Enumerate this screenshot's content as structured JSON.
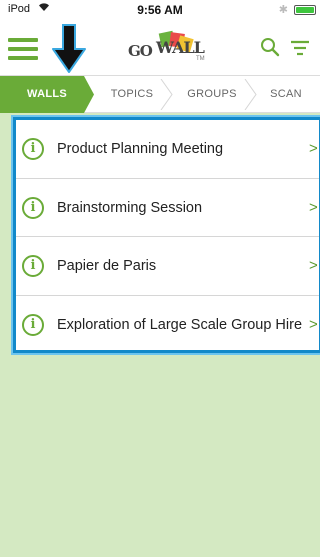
{
  "status_bar": {
    "carrier": "iPod",
    "time": "9:56 AM"
  },
  "header": {
    "logo": {
      "go": "GO",
      "wall": "WALL",
      "tm": "TM"
    },
    "icons": {
      "menu": "hamburger-menu-icon",
      "search": "search-icon",
      "filter": "filter-icon"
    }
  },
  "tabs": [
    {
      "label": "WALLS",
      "active": true
    },
    {
      "label": "TOPICS",
      "active": false
    },
    {
      "label": "GROUPS",
      "active": false
    },
    {
      "label": "SCAN",
      "active": false
    }
  ],
  "walls": {
    "items": [
      {
        "title": "Product Planning Meeting",
        "icon": "info-icon",
        "chevron": ">"
      },
      {
        "title": "Brainstorming Session",
        "icon": "info-icon",
        "chevron": ">"
      },
      {
        "title": "Papier de Paris",
        "icon": "info-icon",
        "chevron": ">"
      },
      {
        "title": "Exploration of Large Scale Group Hire",
        "icon": "info-icon",
        "chevron": ">"
      }
    ]
  },
  "colors": {
    "accent_green": "#6aab38",
    "content_background": "#d4e9c2",
    "highlight_border": "#1289c9"
  }
}
